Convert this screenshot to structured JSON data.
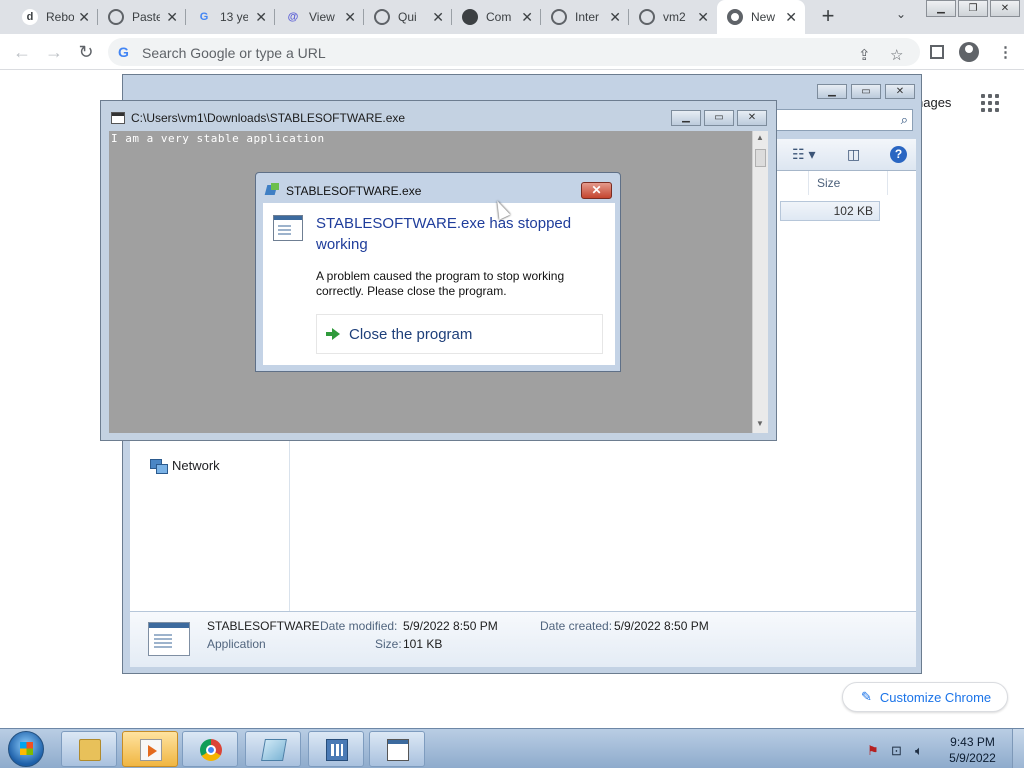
{
  "browser": {
    "tabs": [
      {
        "icon": "d",
        "label": "Rebo",
        "active": false
      },
      {
        "icon": "globe",
        "label": "Paste",
        "active": false
      },
      {
        "icon": "G",
        "label": "13 ye",
        "active": false
      },
      {
        "icon": "@",
        "label": "View",
        "active": false
      },
      {
        "icon": "globe",
        "label": "Qui",
        "active": false
      },
      {
        "icon": "github",
        "label": "Com",
        "active": false
      },
      {
        "icon": "globe",
        "label": "Inter",
        "active": false
      },
      {
        "icon": "globe",
        "label": "vm2",
        "active": false
      },
      {
        "icon": "chrome",
        "label": "New",
        "active": true
      }
    ],
    "omnibox_placeholder": "Search Google or type a URL",
    "ntp_images_label": "nages",
    "customize_label": "Customize Chrome"
  },
  "explorer": {
    "column_size": "Size",
    "file_size": "102 KB",
    "nav_network": "Network",
    "details": {
      "name": "STABLESOFTWARE",
      "type": "Application",
      "date_modified_label": "Date modified:",
      "date_modified": "5/9/2022 8:50 PM",
      "date_created_label": "Date created:",
      "date_created": "5/9/2022 8:50 PM",
      "size_label": "Size:",
      "size": "101 KB"
    }
  },
  "console": {
    "title": "C:\\Users\\vm1\\Downloads\\STABLESOFTWARE.exe",
    "output": "I am a very stable application"
  },
  "dialog": {
    "title": "STABLESOFTWARE.exe",
    "heading": "STABLESOFTWARE.exe has stopped working",
    "message": "A problem caused the program to stop working correctly. Please close the program.",
    "action": "Close the program",
    "close_glyph": "✕"
  },
  "taskbar": {
    "time": "9:43 PM",
    "date": "5/9/2022"
  }
}
